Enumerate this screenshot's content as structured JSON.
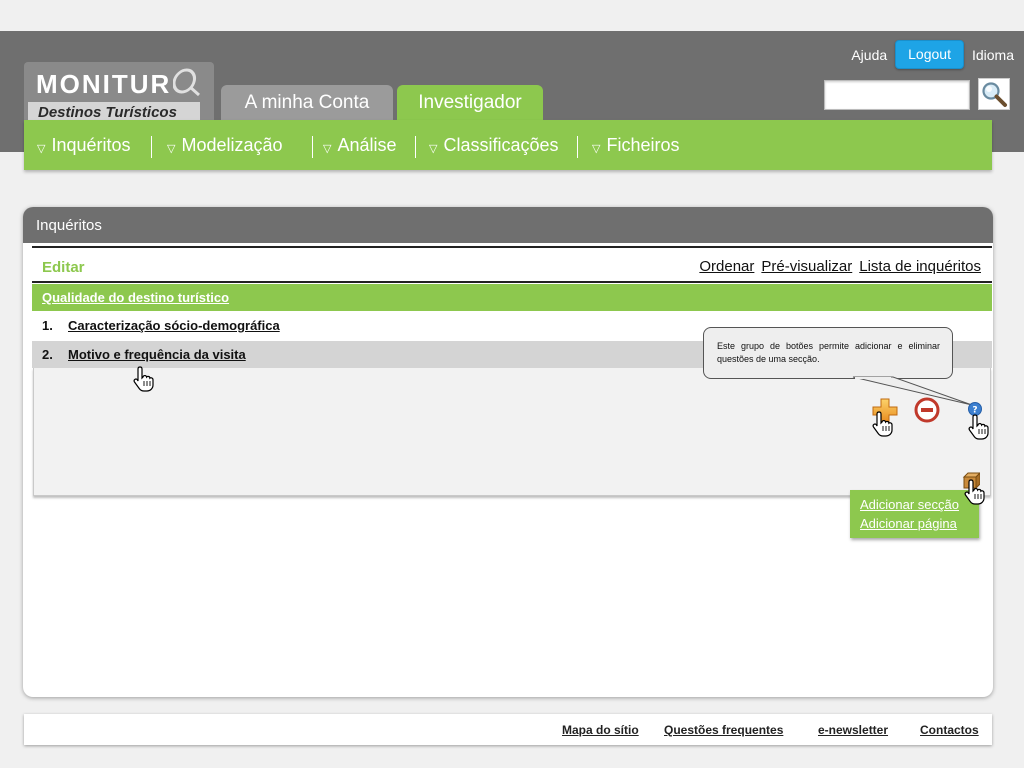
{
  "header": {
    "help": "Ajuda",
    "logout": "Logout",
    "language": "Idioma",
    "search_value": ""
  },
  "logo": {
    "title": "MONITUR",
    "subtitle": "Destinos Turísticos"
  },
  "tabs": [
    {
      "label": "A minha Conta"
    },
    {
      "label": "Investigador"
    }
  ],
  "nav": [
    {
      "label": "Inquéritos"
    },
    {
      "label": "Modelização"
    },
    {
      "label": "Análise"
    },
    {
      "label": "Classificações"
    },
    {
      "label": "Ficheiros"
    }
  ],
  "panel": {
    "title": "Inquéritos",
    "edit_label": "Editar",
    "links": [
      "Ordenar",
      "Pré-visualizar",
      "Lista de inquéritos"
    ],
    "section_title": "Qualidade do destino turístico",
    "questions": [
      {
        "num": "1.",
        "text": "Caracterização sócio-demográfica"
      },
      {
        "num": "2.",
        "text": "Motivo e frequência da visita"
      }
    ]
  },
  "tooltip": {
    "text": "Este grupo de botões permite adicionar e eliminar questões de uma secção."
  },
  "dropdown": {
    "items": [
      "Adicionar secção",
      "Adicionar página"
    ]
  },
  "footer": {
    "links": [
      "Mapa do sítio",
      "Questões frequentes",
      "e-newsletter",
      "Contactos"
    ]
  },
  "colors": {
    "green": "#8dc84e",
    "header_gray": "#6f6f6f",
    "logout_blue": "#1ea4e6",
    "remove_red": "#c0392b"
  }
}
